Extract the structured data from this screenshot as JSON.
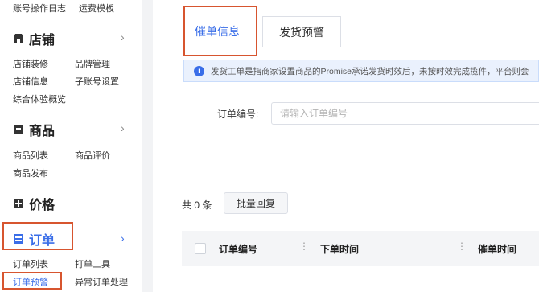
{
  "sidebar": {
    "top_links": [
      "账号操作日志",
      "运费模板"
    ],
    "sections": [
      {
        "title": "店铺",
        "icon": "shop-icon",
        "links": [
          "店铺装修",
          "品牌管理",
          "店铺信息",
          "子账号设置",
          "综合体验概览"
        ]
      },
      {
        "title": "商品",
        "icon": "product-icon",
        "links": [
          "商品列表",
          "商品评价",
          "商品发布"
        ]
      },
      {
        "title": "价格",
        "icon": "price-icon",
        "links": []
      },
      {
        "title": "订单",
        "icon": "order-icon",
        "links": [
          "订单列表",
          "打单工具",
          "订单预警",
          "异常订单处理"
        ]
      }
    ],
    "active_link": "订单预警",
    "chevron": "›"
  },
  "tabs": [
    {
      "label": "催单信息",
      "active": true
    },
    {
      "label": "发货预警",
      "active": false
    }
  ],
  "notice": {
    "icon": "info-icon",
    "text": "发货工单是指商家设置商品的Promise承诺发货时效后，未按时效完成揽件，平台则会"
  },
  "filter": {
    "order_no_label": "订单编号:",
    "order_no_placeholder": "请输入订单编号"
  },
  "list": {
    "total_text": "共 0 条",
    "batch_reply_label": "批量回复",
    "columns": [
      "订单编号",
      "下单时间",
      "催单时间"
    ],
    "column_menu_glyph": "⋮"
  },
  "colors": {
    "accent": "#3a6ee8",
    "highlight_box": "#d7552f",
    "notice_bg": "#eaf1fd"
  }
}
